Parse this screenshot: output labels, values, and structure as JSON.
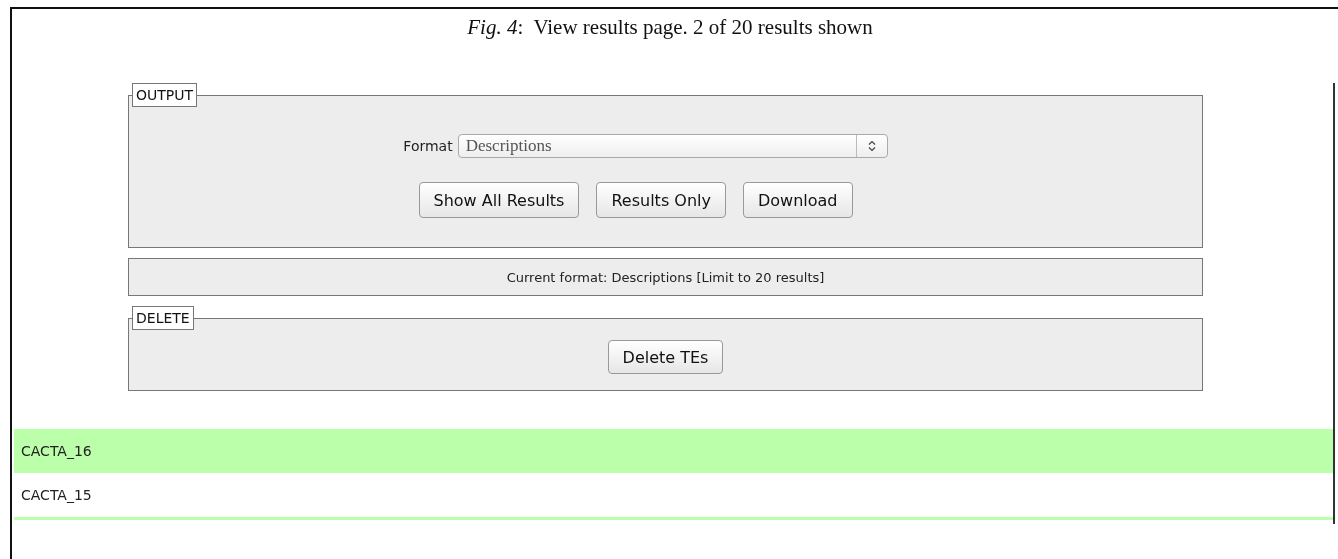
{
  "caption": "*Fig. 4*:  View results page. 2 of 20 results shown",
  "output_panel": {
    "legend": "OUTPUT",
    "format_label": "Format",
    "format_value": "Descriptions",
    "buttons": [
      "Show All Results",
      "Results Only",
      "Download"
    ]
  },
  "status": "Current format: Descriptions [Limit to 20 results]",
  "delete_panel": {
    "legend": "DELETE",
    "buttons": [
      "Delete TEs"
    ]
  },
  "results": [
    {
      "name": "CACTA_16",
      "highlighted": true
    },
    {
      "name": "CACTA_15",
      "highlighted": false
    }
  ]
}
